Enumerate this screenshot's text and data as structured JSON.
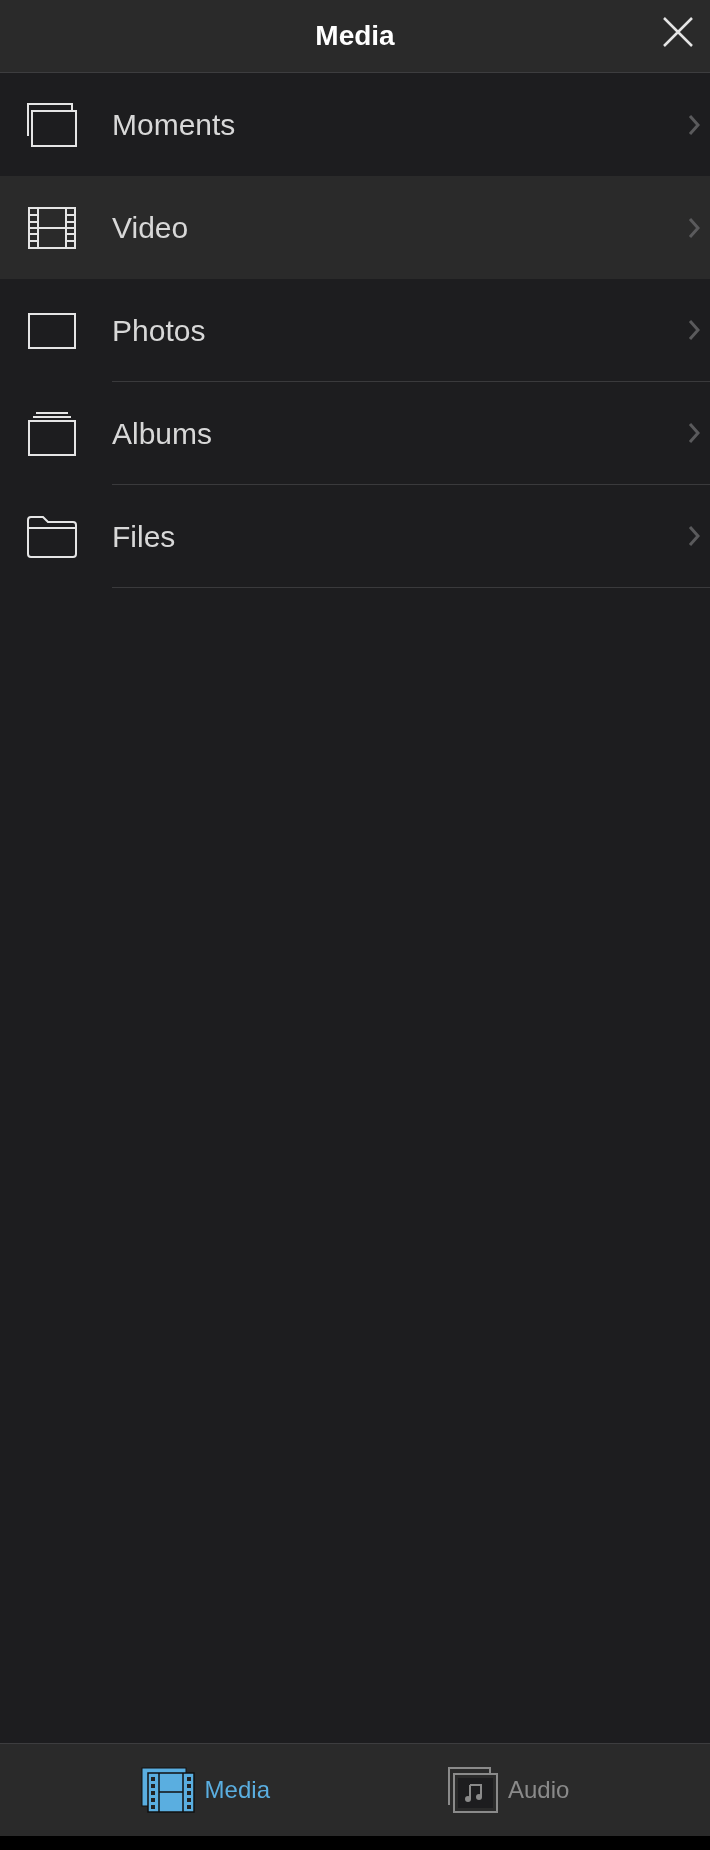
{
  "header": {
    "title": "Media"
  },
  "items": [
    {
      "kind": "moments",
      "label": "Moments",
      "selected": false
    },
    {
      "kind": "video",
      "label": "Video",
      "selected": true
    },
    {
      "kind": "photos",
      "label": "Photos",
      "selected": false
    },
    {
      "kind": "albums",
      "label": "Albums",
      "selected": false
    },
    {
      "kind": "files",
      "label": "Files",
      "selected": false
    }
  ],
  "tabs": [
    {
      "kind": "media",
      "label": "Media",
      "selected": true
    },
    {
      "kind": "audio",
      "label": "Audio",
      "selected": false
    }
  ]
}
